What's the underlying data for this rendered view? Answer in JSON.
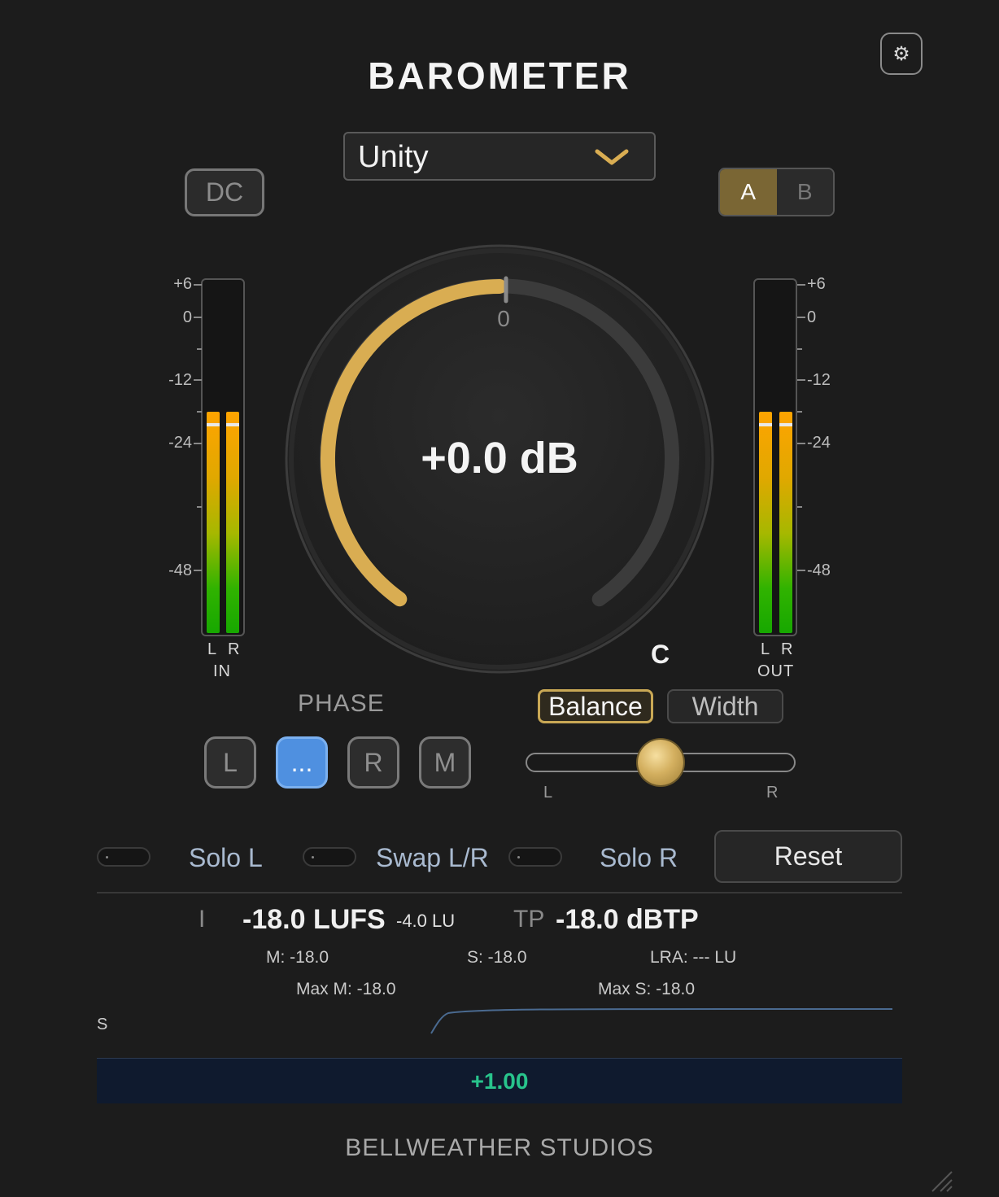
{
  "app": {
    "title": "BAROMETER",
    "brand": "BELLWEATHER STUDIOS"
  },
  "header": {
    "settings_icon": "gear-icon"
  },
  "preset": {
    "value": "Unity",
    "chevron_icon": "chevron-down-icon"
  },
  "dc_button": {
    "label": "DC"
  },
  "ab": {
    "a_label": "A",
    "b_label": "B",
    "selected": "A"
  },
  "meters": {
    "scale": [
      "+6",
      "0",
      "-12",
      "-24",
      "-48"
    ],
    "in": {
      "label": "IN",
      "left_label": "L",
      "right_label": "R"
    },
    "out": {
      "label": "OUT",
      "left_label": "L",
      "right_label": "R"
    }
  },
  "gain_knob": {
    "readout": "+0.0 dB",
    "center_label": "0",
    "value_db": 0.0
  },
  "balance_value_label": "C",
  "phase": {
    "title": "PHASE",
    "buttons": [
      {
        "label": "L",
        "selected": false
      },
      {
        "label": "...",
        "selected": true
      },
      {
        "label": "R",
        "selected": false
      },
      {
        "label": "M",
        "selected": false
      }
    ]
  },
  "stereo": {
    "tabs": [
      {
        "label": "Balance",
        "selected": true
      },
      {
        "label": "Width",
        "selected": false
      }
    ],
    "slider": {
      "left_label": "L",
      "right_label": "R",
      "position": 0.5
    }
  },
  "toggles": [
    {
      "label": "Solo L"
    },
    {
      "label": "Swap L/R"
    },
    {
      "label": "Solo R"
    }
  ],
  "reset_button": {
    "label": "Reset"
  },
  "loudness": {
    "integrated_prefix": "I",
    "integrated": "-18.0 LUFS",
    "relative": "-4.0 LU",
    "tp_prefix": "TP",
    "true_peak": "-18.0 dBTP",
    "momentary": "M: -18.0",
    "short_term": "S: -18.0",
    "lra": "LRA: --- LU",
    "max_m": "Max M: -18.0",
    "max_s": "Max S: -18.0",
    "graph_label": "S",
    "correlation": "+1.00"
  },
  "colors": {
    "accent_gold": "#d9ad52",
    "selected_blue": "#4f90e0",
    "correlation_green": "#28c48c"
  }
}
